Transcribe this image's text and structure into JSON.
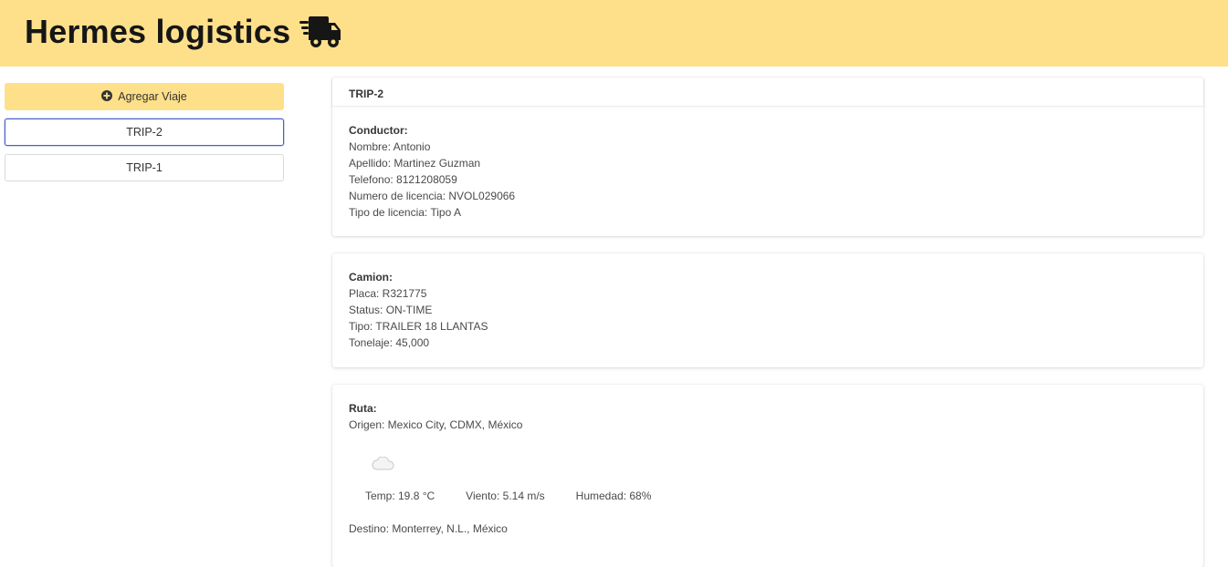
{
  "app": {
    "title": "Hermes logistics",
    "logo_icon": "truck-fast-icon"
  },
  "sidebar": {
    "add_button": {
      "icon": "plus-circle-icon",
      "label": "Agregar Viaje"
    },
    "trips": [
      {
        "label": "TRIP-2",
        "selected": true
      },
      {
        "label": "TRIP-1",
        "selected": false
      }
    ]
  },
  "trip": {
    "title": "TRIP-2",
    "driver": {
      "heading": "Conductor:",
      "nombre": "Nombre: Antonio",
      "apellido": "Apellido: Martinez Guzman",
      "telefono": "Telefono: 8121208059",
      "licencia": "Numero de licencia: NVOL029066",
      "tipo_licencia": "Tipo de licencia: Tipo A"
    },
    "truck": {
      "heading": "Camion:",
      "placa": "Placa: R321775",
      "status": "Status: ON-TIME",
      "tipo": "Tipo: TRAILER 18 LLANTAS",
      "tonelaje": "Tonelaje: 45,000"
    },
    "route": {
      "heading": "Ruta:",
      "origen": "Origen: Mexico City, CDMX, México",
      "weather": {
        "icon": "cloud-icon",
        "temp": "Temp: 19.8 °C",
        "viento": "Viento: 5.14 m/s",
        "humedad": "Humedad: 68%"
      },
      "destino": "Destino: Monterrey, N.L., México"
    }
  },
  "colors": {
    "navbar": "#ffe08a",
    "selected_border": "#485fc7"
  }
}
